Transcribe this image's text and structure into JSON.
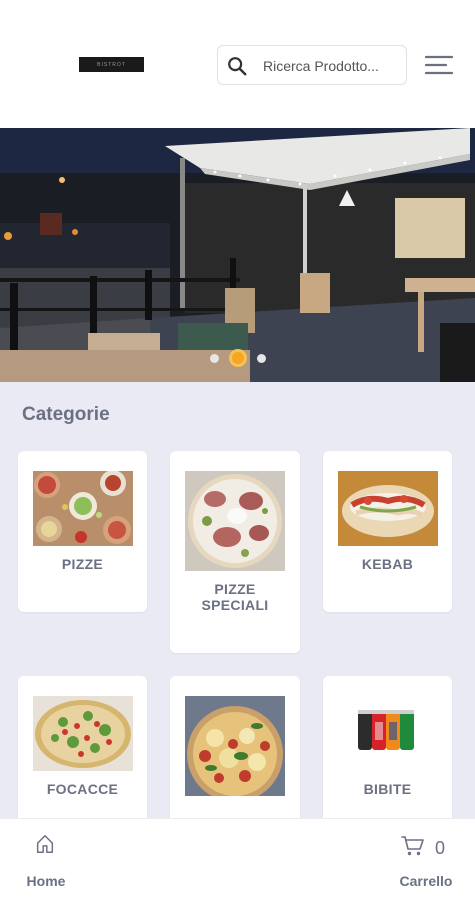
{
  "header": {
    "logo_text": "BISTROT",
    "search_placeholder": "Ricerca Prodotto...",
    "search_icon": "search-icon",
    "menu_icon": "hamburger-menu-icon"
  },
  "hero": {
    "slides_count": 3,
    "active_slide": 2
  },
  "categories": {
    "title": "Categorie",
    "items": [
      {
        "name": "PIZZE"
      },
      {
        "name": "PIZZE SPECIALI"
      },
      {
        "name": "KEBAB"
      },
      {
        "name": "FOCACCE"
      },
      {
        "name": ""
      },
      {
        "name": "BIBITE"
      }
    ]
  },
  "bottom_nav": {
    "home_label": "Home",
    "home_icon": "home-icon",
    "cart_label": "Carrello",
    "cart_count": "0",
    "cart_icon": "cart-icon"
  },
  "colors": {
    "accent": "#f5a623",
    "text_muted": "#6b7083",
    "background": "#e9eaf4"
  }
}
